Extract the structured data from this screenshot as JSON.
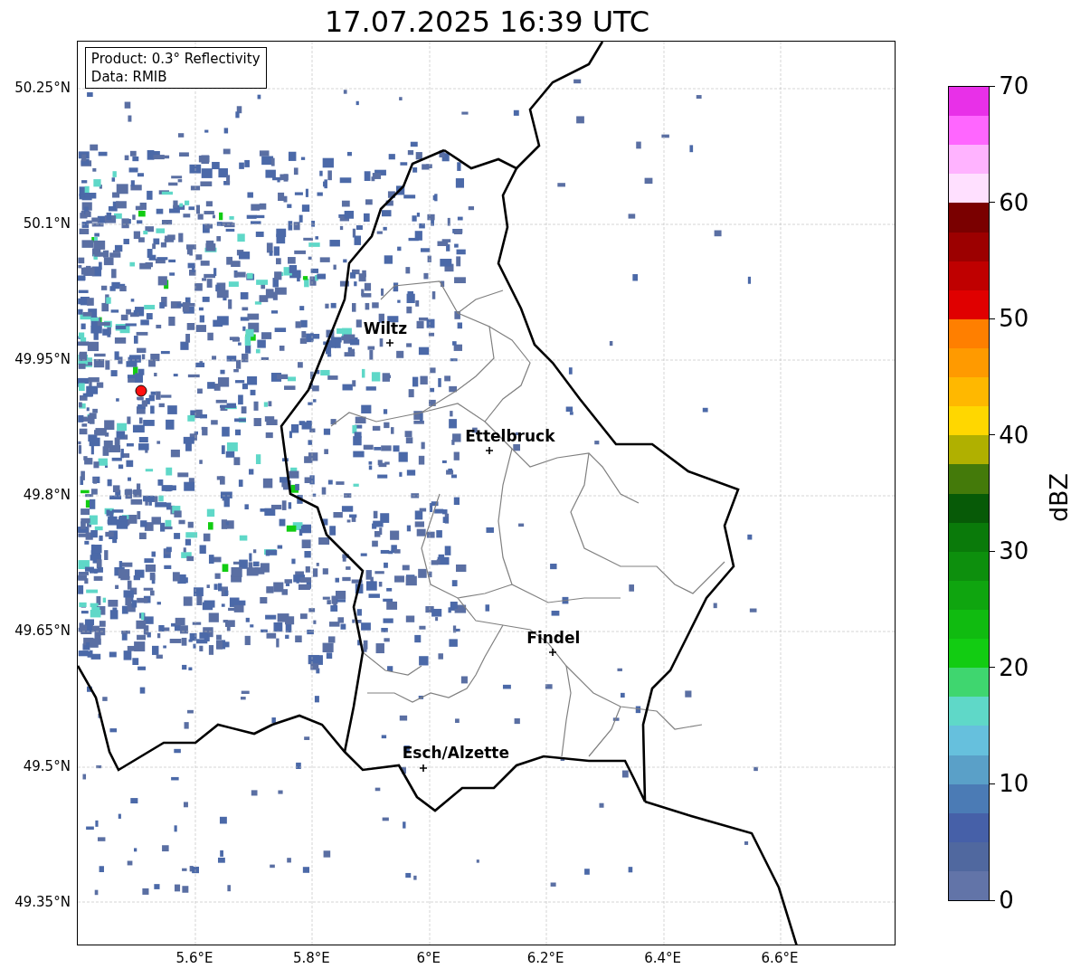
{
  "title": "17.07.2025 16:39 UTC",
  "legend": [
    "Product: 0.3° Reflectivity",
    "Data: RMIB"
  ],
  "y_ticks": [
    "50.25°N",
    "50.1°N",
    "49.95°N",
    "49.8°N",
    "49.65°N",
    "49.5°N",
    "49.35°N"
  ],
  "x_ticks": [
    "5.6°E",
    "5.8°E",
    "6°E",
    "6.2°E",
    "6.4°E",
    "6.6°E"
  ],
  "cities": [
    {
      "name": "Wiltz"
    },
    {
      "name": "Ettelbruck"
    },
    {
      "name": "Findel"
    },
    {
      "name": "Esch/Alzette"
    }
  ],
  "colorbar": {
    "label": "dBZ",
    "ticks": [
      "70",
      "60",
      "50",
      "40",
      "30",
      "20",
      "10",
      "0"
    ],
    "levels": [
      {
        "color": "#e830e8"
      },
      {
        "color": "#ff66ff"
      },
      {
        "color": "#ffb3ff"
      },
      {
        "color": "#ffe0ff"
      },
      {
        "color": "#7a0000"
      },
      {
        "color": "#9c0000"
      },
      {
        "color": "#bf0000"
      },
      {
        "color": "#e00000"
      },
      {
        "color": "#ff7f00"
      },
      {
        "color": "#ff9a00"
      },
      {
        "color": "#ffb800"
      },
      {
        "color": "#ffd700"
      },
      {
        "color": "#b0b000"
      },
      {
        "color": "#447a0a"
      },
      {
        "color": "#075a07"
      },
      {
        "color": "#0a7a0a"
      },
      {
        "color": "#0d8f0d"
      },
      {
        "color": "#0fa50f"
      },
      {
        "color": "#10bb10"
      },
      {
        "color": "#12cc12"
      },
      {
        "color": "#3fd66f"
      },
      {
        "color": "#5fd8c8"
      },
      {
        "color": "#66c0dd"
      },
      {
        "color": "#5aa0c8"
      },
      {
        "color": "#4b7bb5"
      },
      {
        "color": "#4660a8"
      },
      {
        "color": "#50689f"
      },
      {
        "color": "#6274a8"
      }
    ]
  }
}
